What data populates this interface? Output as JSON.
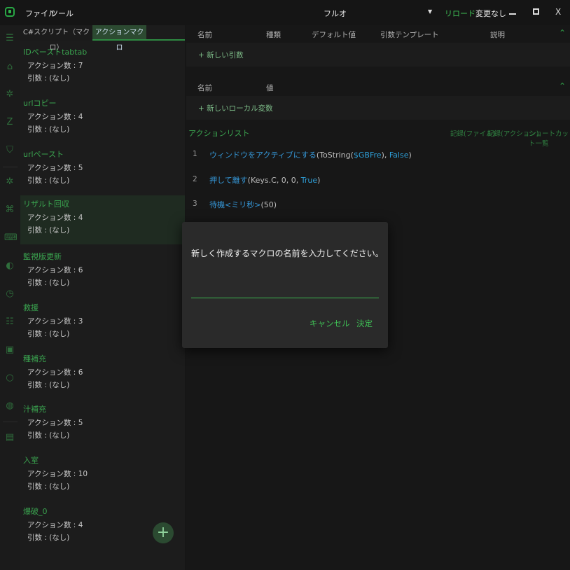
{
  "titlebar": {
    "menu": [
      "ファイル",
      "ツール"
    ],
    "title": "フルオ",
    "dropdown_glyph": "▼",
    "reload_label": "リロード",
    "status": "変更なし",
    "close_glyph": "X"
  },
  "sidebar_icons": [
    "menu-icon",
    "home-icon",
    "settings-icon",
    "sleep-icon",
    "shield-icon",
    "gear-icon",
    "command-icon",
    "keyboard-icon",
    "gamepad-icon",
    "alarm-icon",
    "list-icon",
    "image-icon",
    "circle-icon",
    "info-icon",
    "save-icon"
  ],
  "tabs": {
    "csharp": "C#スクリプト（マクロ）",
    "actionmacro": "アクションマクロ"
  },
  "macros": [
    {
      "name": "IDペーストtabtab",
      "actions": "アクション数 : 7",
      "args": "引数 : (なし)"
    },
    {
      "name": "urlコピー",
      "actions": "アクション数 : 4",
      "args": "引数 : (なし)"
    },
    {
      "name": "urlペースト",
      "actions": "アクション数 : 5",
      "args": "引数 : (なし)"
    },
    {
      "name": "リザルト回収",
      "actions": "アクション数 : 4",
      "args": "引数 : (なし)"
    },
    {
      "name": "監視版更新",
      "actions": "アクション数 : 6",
      "args": "引数 : (なし)"
    },
    {
      "name": "救援",
      "actions": "アクション数 : 3",
      "args": "引数 : (なし)"
    },
    {
      "name": "種補充",
      "actions": "アクション数 : 6",
      "args": "引数 : (なし)"
    },
    {
      "name": "汁補充",
      "actions": "アクション数 : 5",
      "args": "引数 : (なし)"
    },
    {
      "name": "入室",
      "actions": "アクション数 : 10",
      "args": "引数 : (なし)"
    },
    {
      "name": "爆破_0",
      "actions": "アクション数 : 4",
      "args": "引数 : (なし)"
    }
  ],
  "selected_macro_index": 3,
  "fab_glyph": "+",
  "args_table": {
    "headers": [
      "名前",
      "種類",
      "デフォルト値",
      "引数テンプレート",
      "説明"
    ],
    "add_label": "+ 新しい引数"
  },
  "locals_table": {
    "headers": [
      "名前",
      "値"
    ],
    "add_label": "+ 新しいローカル変数"
  },
  "action_list": {
    "title": "アクションリスト",
    "links": [
      "記録(ファイル)",
      "記録(アクション)",
      "ショートカット一覧"
    ],
    "items": [
      {
        "num": "1",
        "name": "ウィンドウをアクティブにする",
        "args_open": "(ToString(",
        "arg1": "$GBFre",
        "mid": "), ",
        "arg2": "False",
        "args_close": ")"
      },
      {
        "num": "2",
        "name": "押して離す",
        "args_open": "(Keys.C, 0, 0, ",
        "arg2": "True",
        "args_close": ")"
      },
      {
        "num": "3",
        "name": "待機<ミリ秒>",
        "args_open": "(50)"
      }
    ]
  },
  "dialog": {
    "message": "新しく作成するマクロの名前を入力してください。",
    "input_value": "",
    "cancel_label": "キャンセル",
    "ok_label": "決定"
  },
  "colors": {
    "accent": "#3aa34f",
    "link": "#3596d6",
    "background": "#161616"
  }
}
